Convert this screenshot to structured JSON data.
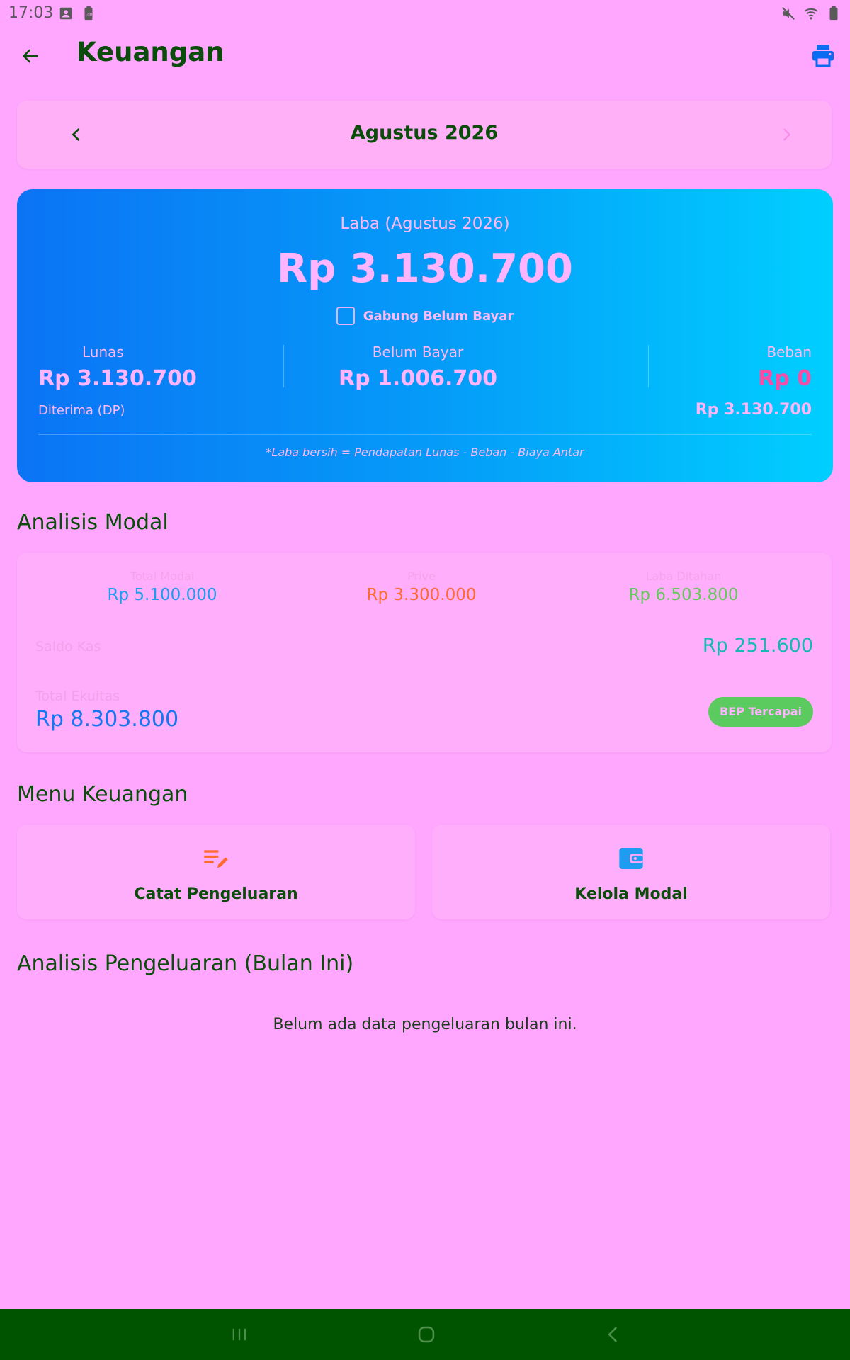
{
  "status_bar": {
    "time": "17:03"
  },
  "app_bar": {
    "title": "Keuangan",
    "back_icon": "arrow-left-icon",
    "print_icon": "printer-icon"
  },
  "month_selector": {
    "label": "Agustus 2026"
  },
  "profit_card": {
    "title": "Laba (Agustus 2026)",
    "value": "Rp 3.130.700",
    "merge_label": "Gabung Belum Bayar",
    "lunas_label": "Lunas",
    "lunas_value": "Rp 3.130.700",
    "belum_label": "Belum Bayar",
    "belum_value": "Rp 1.006.700",
    "beban_label": "Beban",
    "beban_value": "Rp 0",
    "dp_label": "Diterima (DP)",
    "dp_value": "Rp 3.130.700",
    "note": "*Laba bersih = Pendapatan Lunas - Beban - Biaya Antar"
  },
  "capital_analysis": {
    "heading": "Analisis Modal",
    "total_modal_label": "Total Modal",
    "total_modal_value": "Rp 5.100.000",
    "prive_label": "Prive",
    "prive_value": "Rp 3.300.000",
    "laba_ditahan_label": "Laba Ditahan",
    "laba_ditahan_value": "Rp 6.503.800",
    "saldo_kas_label": "Saldo Kas",
    "saldo_kas_value": "Rp 251.600",
    "total_ekuitas_label": "Total Ekuitas",
    "total_ekuitas_value": "Rp 8.303.800",
    "bep_badge": "BEP Tercapai"
  },
  "finance_menu": {
    "heading": "Menu Keuangan",
    "items": [
      {
        "label": "Catat Pengeluaran",
        "icon": "edit-note-icon"
      },
      {
        "label": "Kelola Modal",
        "icon": "wallet-icon"
      }
    ]
  },
  "expense_analysis": {
    "heading": "Analisis Pengeluaran (Bulan Ini)",
    "empty_text": "Belum ada data pengeluaran bulan ini."
  },
  "colors": {
    "background": "#FFA6FF",
    "title_green": "#0a4d0a",
    "card_gradient_start": "#0B74F5",
    "card_gradient_end": "#00CFFF",
    "beban_red": "#F94CA6",
    "bep_green": "#5CCB5F",
    "nav_bar": "#005400"
  }
}
